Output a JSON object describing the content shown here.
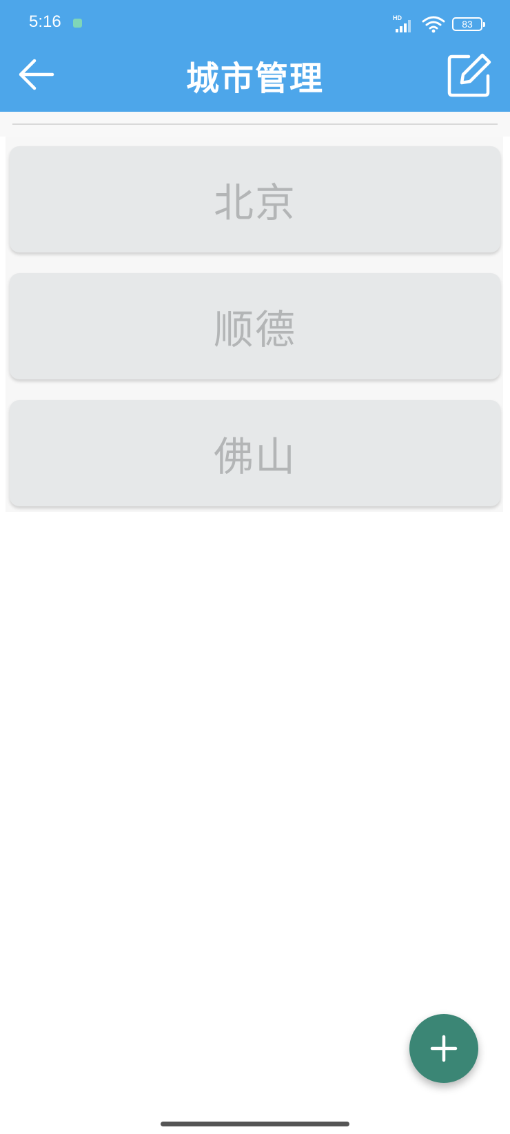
{
  "status_bar": {
    "time": "5:16",
    "network_label": "HD",
    "battery_level": "83",
    "notification_color": "#7fd6b8"
  },
  "app_bar": {
    "title": "城市管理",
    "back_icon": "arrow-left-icon",
    "edit_icon": "edit-square-icon",
    "background_color": "#4da6ea"
  },
  "cities": [
    {
      "name": "北京"
    },
    {
      "name": "顺德"
    },
    {
      "name": "佛山"
    }
  ],
  "fab": {
    "icon": "plus-icon",
    "color": "#3b8675"
  }
}
